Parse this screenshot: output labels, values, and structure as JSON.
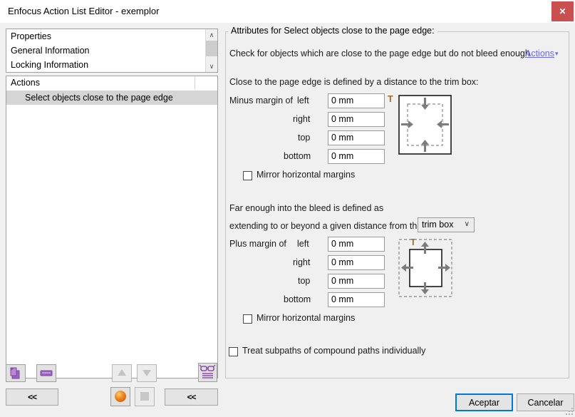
{
  "window": {
    "title": "Enfocus Action List Editor - exemplor",
    "close_label": "✕",
    "close_icon": "close-icon"
  },
  "left_panel": {
    "properties_list": [
      {
        "label": "Properties"
      },
      {
        "label": "General Information"
      },
      {
        "label": "Locking Information"
      }
    ],
    "scroll": {
      "up": "∧",
      "down": "∨"
    },
    "actions_header": "Actions",
    "actions_rows": [
      {
        "label": "Select objects close to the page edge",
        "selected": true
      }
    ],
    "toolbar": {
      "add_icon": "add-action-icon",
      "remove_icon": "remove-action-icon",
      "move_up_icon": "move-up-icon",
      "move_down_icon": "move-down-icon",
      "preview_icon": "glasses-preview-icon",
      "sphere_icon": "orange-sphere-icon",
      "square_icon": "gray-square-icon",
      "collapse_left_label": "<<",
      "collapse_right_label": "<<"
    }
  },
  "attributes": {
    "group_title": "Attributes for Select objects close to the page edge:",
    "description": "Check for objects which are close to the page edge but do not bleed enough",
    "actions_link": "Actions",
    "actions_link_caret": "▾",
    "close_section": {
      "heading": "Close to the page edge is defined by a distance to the trim box:",
      "group_label": "Minus margin of",
      "fields": [
        {
          "label": "left",
          "value": "0 mm"
        },
        {
          "label": "right",
          "value": "0 mm"
        },
        {
          "label": "top",
          "value": "0 mm"
        },
        {
          "label": "bottom",
          "value": "0 mm"
        }
      ],
      "mirror_label": "Mirror horizontal margins",
      "mirror_checked": false,
      "diagram_marker": "T"
    },
    "bleed_section": {
      "heading": "Far enough into the bleed is defined as",
      "subheading": "extending to or beyond a given distance from the",
      "box_select_value": "trim box",
      "box_select_caret": "∨",
      "group_label": "Plus margin of",
      "fields": [
        {
          "label": "left",
          "value": "0 mm"
        },
        {
          "label": "right",
          "value": "0 mm"
        },
        {
          "label": "top",
          "value": "0 mm"
        },
        {
          "label": "bottom",
          "value": "0 mm"
        }
      ],
      "mirror_label": "Mirror horizontal margins",
      "mirror_checked": false,
      "diagram_marker": "T"
    },
    "subpaths_label": "Treat subpaths of compound paths individually",
    "subpaths_checked": false
  },
  "footer": {
    "accept_label": "Aceptar",
    "cancel_label": "Cancelar"
  },
  "colors": {
    "accent_link": "#6a6aee",
    "close_button": "#c9504f",
    "focus_border": "#0078d7",
    "icon_purple": "#8a4fb0",
    "sphere_orange": "#f08a1e",
    "selection_gray": "#d5d5d5",
    "window_bg": "#f0f0f0"
  }
}
